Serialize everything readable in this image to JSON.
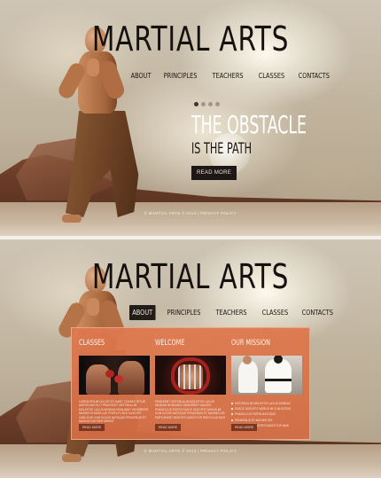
{
  "site": {
    "title": "MARTIAL ARTS",
    "nav": [
      "ABOUT",
      "PRINCIPLES",
      "TEACHERS",
      "CLASSES",
      "CONTACTS"
    ],
    "footer": "© MARTIAL ARTS © 2013 | PRIVACY POLICY"
  },
  "slider": {
    "headline": "THE OBSTACLE",
    "subheadline": "IS THE PATH",
    "button": "READ MORE",
    "dots": 4,
    "active_dot": 0
  },
  "about": {
    "active_nav": "ABOUT",
    "columns": [
      {
        "title": "CLASSES",
        "image": "boxing-fighters-image",
        "text": "LOREM IPSUM DOLOR SIT AMET CONSECTETUR ADIPISCING ELIT PRAESENT VESTIBULUM MOLESTIE LACUS AENEAN NONUMMY HENDRERIT MAURIS PHASELLUS PORTA FUSCE SUSCIPIT VARIUS MI CUM SOCIIS NATOQUE PENATIBUS ET MAGNIS DIS PARTURIENT",
        "button": "READ MORE"
      },
      {
        "title": "WELCOME",
        "image": "fencing-helmet-image",
        "text": "PRAESENT VESTIBULUM MOLESTIE LACUS AENEAN NONUMMY HENDRERIT MAURIS PHASELLUS PORTA FUSCE SUSCIPIT VARIUS MI CUM SOCIIS NATOQUE PENATIBUS ET MAGNIS DIS PARTURIENT MONTES NASCETUR RIDICULUS MUS",
        "button": "READ MORE"
      },
      {
        "title": "OUR MISSION",
        "image": "karate-students-image",
        "list": [
          "VESTIBULUM MOLESTIE LACUS AENEAN",
          "FUSCE SUSCIPIT VARIUS MI CUM SOCIIS",
          "PHASELLUS PORTA NATOQUE",
          "PENATIBUS ET MAGNIS DIS",
          "PARTURIENT MONTES NASCETUR MUS"
        ],
        "button": "READ MORE"
      }
    ]
  },
  "colors": {
    "accent_orange": "#de784e",
    "dark_button": "#1d1815",
    "title": "#14110f"
  }
}
